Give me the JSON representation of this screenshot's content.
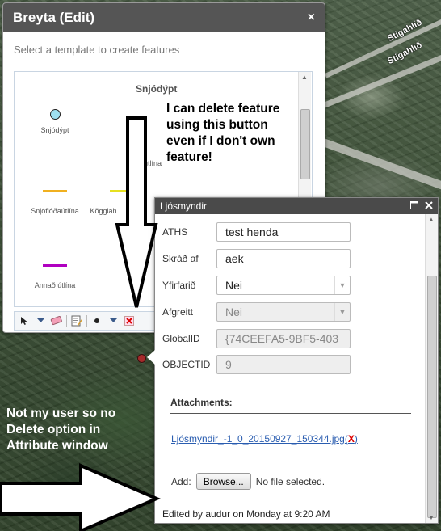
{
  "map": {
    "road_labels": [
      "Stigahlíð",
      "Stigahlíð"
    ]
  },
  "edit_panel": {
    "title": "Breyta (Edit)",
    "close": "×",
    "subtitle": "Select a template to create features",
    "group_heading": "Snjódýpt",
    "templates": [
      {
        "label": "Snjódýpt",
        "type": "point",
        "color": "#9fe0f0"
      },
      {
        "label": "Snjóflóðaútlína",
        "type": "line",
        "color": "#f0b020"
      },
      {
        "label": "Kögglah",
        "type": "line",
        "color": "#e6e020"
      },
      {
        "label": "Annað útlína",
        "type": "line",
        "color": "#b000c0"
      }
    ],
    "partial_label": "útlína",
    "toolbar_icons": [
      "select-arrow-icon",
      "dropdown-icon",
      "eraser-icon",
      "attributes-icon",
      "point-icon",
      "dropdown-icon",
      "delete-icon"
    ]
  },
  "annotations": {
    "top_note": [
      "I can delete feature",
      "using this button",
      "even if I don't own",
      "feature!"
    ],
    "bottom_note": [
      "Not my user so no",
      "Delete option in",
      "Attribute window"
    ]
  },
  "popup": {
    "title": "Ljósmyndir",
    "fields": [
      {
        "label": "ATHS",
        "value": "test henda",
        "type": "text",
        "disabled": false
      },
      {
        "label": "Skráð af",
        "value": "aek",
        "type": "text",
        "disabled": false
      },
      {
        "label": "Yfirfarið",
        "value": "Nei",
        "type": "select",
        "disabled": false
      },
      {
        "label": "Afgreitt",
        "value": "Nei",
        "type": "select",
        "disabled": true
      },
      {
        "label": "GlobalID",
        "value": "{74CEEFA5-9BF5-403",
        "type": "text",
        "disabled": true
      },
      {
        "label": "OBJECTID",
        "value": "9",
        "type": "text",
        "disabled": true
      }
    ],
    "attachments_heading": "Attachments:",
    "attachment_file": "Ljósmyndir_-1_0_20150927_150344.jpg",
    "attachment_delete": "X",
    "add_label": "Add:",
    "browse_label": "Browse...",
    "no_file_text": "No file selected.",
    "edited_by": "Edited by audur on Monday at 9:20 AM"
  }
}
